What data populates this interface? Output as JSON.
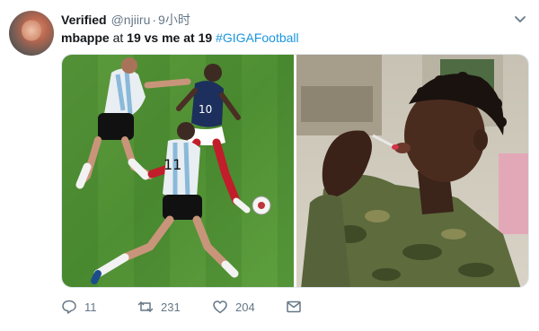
{
  "tweet": {
    "author": {
      "name": "Verified",
      "handle": "@njiiru",
      "time": "9小时"
    },
    "text": {
      "part1": "mbappe",
      "part2": " at ",
      "part3": "19",
      "part4": " vs me at ",
      "part5": "19",
      "hashtag": "#GIGAFootball"
    },
    "media": {
      "left_image": "football-match-photo",
      "right_image": "man-blowing-bubbles-photo"
    },
    "actions": {
      "replies": "11",
      "retweets": "231",
      "likes": "204"
    }
  },
  "icons": {
    "reply": "reply-icon",
    "retweet": "retweet-icon",
    "like": "heart-icon",
    "dm": "envelope-icon",
    "menu": "chevron-down-icon"
  },
  "colors": {
    "link": "#1b95e0",
    "muted": "#657786",
    "text": "#14171a"
  }
}
